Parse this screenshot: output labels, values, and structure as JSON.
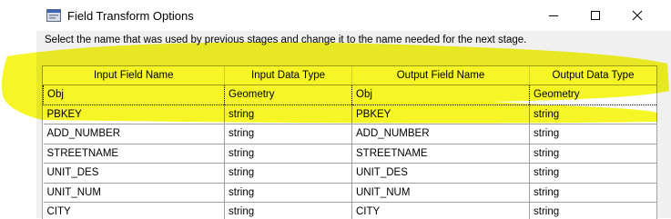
{
  "window": {
    "title": "Field Transform Options",
    "buttons": {
      "minimize": "minimize-icon",
      "maximize": "maximize-icon",
      "close": "close-icon"
    }
  },
  "instruction": "Select the name that was used by previous stages and change it to the name needed for the next stage.",
  "grid": {
    "columns": [
      "Input Field Name",
      "Input Data Type",
      "Output Field Name",
      "Output Data Type"
    ],
    "rows": [
      [
        "Obj",
        "Geometry",
        "Obj",
        "Geometry"
      ],
      [
        "PBKEY",
        "string",
        "PBKEY",
        "string"
      ],
      [
        "ADD_NUMBER",
        "string",
        "ADD_NUMBER",
        "string"
      ],
      [
        "STREETNAME",
        "string",
        "STREETNAME",
        "string"
      ],
      [
        "UNIT_DES",
        "string",
        "UNIT_DES",
        "string"
      ],
      [
        "UNIT_NUM",
        "string",
        "UNIT_NUM",
        "string"
      ],
      [
        "CITY",
        "string",
        "CITY",
        "string"
      ]
    ]
  },
  "colors": {
    "highlighter": "#f5f500",
    "grid_border": "#a0a0a0",
    "client_background": "#f0f0f0"
  }
}
